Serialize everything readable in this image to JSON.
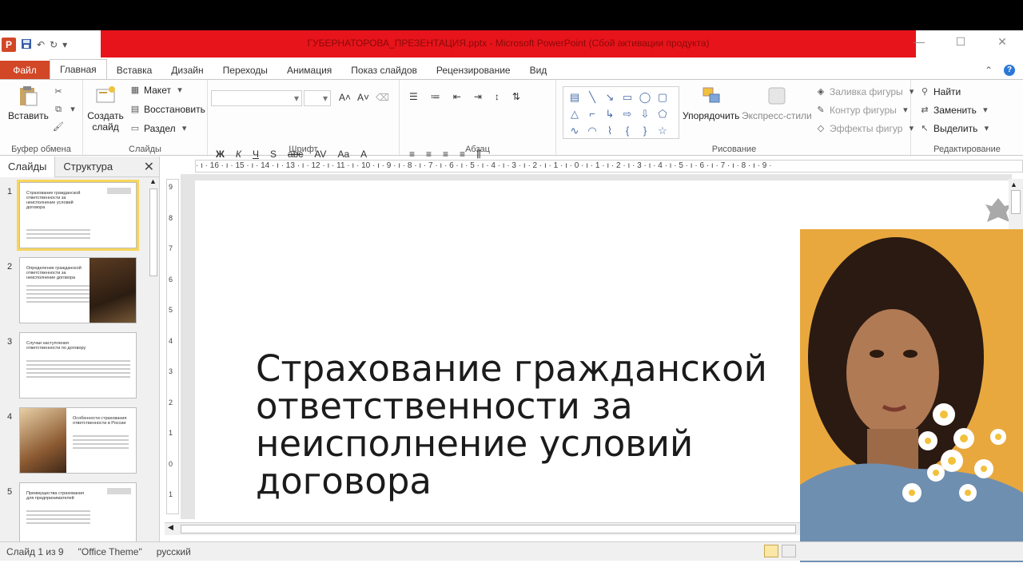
{
  "window": {
    "title": "ГУБЕРНАТОРОВА_ПРЕЗЕНТАЦИЯ.pptx - Microsoft PowerPoint (Сбой активации продукта)",
    "controls": [
      "—",
      "☐",
      "✕"
    ]
  },
  "qat": {
    "logo": "P",
    "save_icon": "save-icon",
    "undo": "↶",
    "redo": "↻"
  },
  "tabs": {
    "file": "Файл",
    "items": [
      "Главная",
      "Вставка",
      "Дизайн",
      "Переходы",
      "Анимация",
      "Показ слайдов",
      "Рецензирование",
      "Вид"
    ],
    "active": "Главная"
  },
  "ribbon": {
    "clipboard": {
      "label": "Буфер обмена",
      "paste": "Вставить"
    },
    "slides": {
      "label": "Слайды",
      "new_slide": "Создать слайд",
      "layout": "Макет",
      "reset": "Восстановить",
      "section": "Раздел"
    },
    "font": {
      "label": "Шрифт",
      "font_value": "",
      "size_value": "",
      "bold": "Ж",
      "italic": "К",
      "underline": "Ч",
      "shadow": "S",
      "strike": "abc",
      "spacing": "AV",
      "case": "Aa",
      "color": "A"
    },
    "paragraph": {
      "label": "Абзац"
    },
    "drawing": {
      "label": "Рисование",
      "arrange": "Упорядочить",
      "quick_styles": "Экспресс-стили",
      "fill": "Заливка фигуры",
      "outline": "Контур фигуры",
      "effects": "Эффекты фигур"
    },
    "editing": {
      "label": "Редактирование",
      "find": "Найти",
      "replace": "Заменить",
      "select": "Выделить"
    }
  },
  "left_panel": {
    "tabs": [
      "Слайды",
      "Структура"
    ],
    "active_tab": "Слайды",
    "slides": [
      {
        "num": "1",
        "title": "Страхование гражданской ответственности за неисполнение условий договора",
        "selected": true
      },
      {
        "num": "2",
        "title": "Определение гражданской ответственности за неисполнение договора",
        "selected": false
      },
      {
        "num": "3",
        "title": "Случаи наступления ответственности по договору",
        "selected": false
      },
      {
        "num": "4",
        "title": "Особенности страхования ответственности в России",
        "selected": false
      },
      {
        "num": "5",
        "title": "Преимущества страхования для предпринимателей",
        "selected": false
      }
    ]
  },
  "ruler": {
    "h_ticks": "· ı · 16 · ı · 15 · ı · 14 · ı · 13 · ı · 12 · ı · 11 · ı · 10 · ı · 9 · ı · 8 · ı · 7 · ı · 6 · ı · 5 · ı · 4 · ı · 3 · ı · 2 · ı · 1 · ı · 0 · ı · 1 · ı · 2 · ı · 3 · ı · 4 · ı · 5 · ı · 6 · ı · 7 · ı · 8 · ı · 9 ·",
    "v_ticks": [
      "9",
      "8",
      "7",
      "6",
      "5",
      "4",
      "3",
      "2",
      "1",
      "0",
      "1"
    ]
  },
  "slide": {
    "title": "Страхование гражданской ответственности за неисполнение условий договора"
  },
  "status": {
    "slide_counter": "Слайд 1 из 9",
    "theme": "\"Office Theme\"",
    "language": "русский"
  }
}
